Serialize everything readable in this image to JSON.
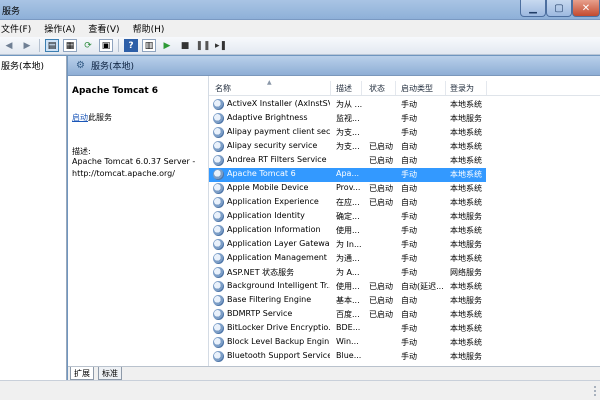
{
  "window": {
    "title": "服务"
  },
  "menu": [
    "文件(F)",
    "操作(A)",
    "查看(V)",
    "帮助(H)"
  ],
  "tree": {
    "root": "服务(本地)"
  },
  "pane_header": "服务(本地)",
  "detail": {
    "service_name": "Apache Tomcat 6",
    "start_link": "启动",
    "start_suffix": "此服务",
    "desc_label": "描述:",
    "desc_text": "Apache Tomcat 6.0.37 Server - http://tomcat.apache.org/"
  },
  "columns": [
    "名称",
    "描述",
    "状态",
    "启动类型",
    "登录为"
  ],
  "rows": [
    {
      "name": "ActiveX Installer (AxInstSV)",
      "desc": "为从 ...",
      "status": "",
      "startup": "手动",
      "logon": "本地系统"
    },
    {
      "name": "Adaptive Brightness",
      "desc": "监视...",
      "status": "",
      "startup": "手动",
      "logon": "本地服务"
    },
    {
      "name": "Alipay payment client sec...",
      "desc": "为支...",
      "status": "",
      "startup": "手动",
      "logon": "本地系统"
    },
    {
      "name": "Alipay security service",
      "desc": "为支...",
      "status": "已启动",
      "startup": "自动",
      "logon": "本地系统"
    },
    {
      "name": "Andrea RT Filters Service",
      "desc": "",
      "status": "已启动",
      "startup": "自动",
      "logon": "本地系统"
    },
    {
      "name": "Apache Tomcat 6",
      "desc": "Apa...",
      "status": "",
      "startup": "手动",
      "logon": "本地系统",
      "selected": true
    },
    {
      "name": "Apple Mobile Device",
      "desc": "Prov...",
      "status": "已启动",
      "startup": "自动",
      "logon": "本地系统"
    },
    {
      "name": "Application Experience",
      "desc": "在应...",
      "status": "已启动",
      "startup": "自动",
      "logon": "本地系统"
    },
    {
      "name": "Application Identity",
      "desc": "确定...",
      "status": "",
      "startup": "手动",
      "logon": "本地服务"
    },
    {
      "name": "Application Information",
      "desc": "使用...",
      "status": "",
      "startup": "手动",
      "logon": "本地系统"
    },
    {
      "name": "Application Layer Gatewa...",
      "desc": "为 In...",
      "status": "",
      "startup": "手动",
      "logon": "本地服务"
    },
    {
      "name": "Application Management",
      "desc": "为通...",
      "status": "",
      "startup": "手动",
      "logon": "本地系统"
    },
    {
      "name": "ASP.NET 状态服务",
      "desc": "为 A...",
      "status": "",
      "startup": "手动",
      "logon": "网络服务"
    },
    {
      "name": "Background Intelligent Tr...",
      "desc": "使用...",
      "status": "已启动",
      "startup": "自动(延迟...",
      "logon": "本地系统"
    },
    {
      "name": "Base Filtering Engine",
      "desc": "基本...",
      "status": "已启动",
      "startup": "自动",
      "logon": "本地服务"
    },
    {
      "name": "BDMRTP Service",
      "desc": "百度...",
      "status": "已启动",
      "startup": "自动",
      "logon": "本地系统"
    },
    {
      "name": "BitLocker Drive Encryptio...",
      "desc": "BDE...",
      "status": "",
      "startup": "手动",
      "logon": "本地系统"
    },
    {
      "name": "Block Level Backup Engin...",
      "desc": "Win...",
      "status": "",
      "startup": "手动",
      "logon": "本地系统"
    },
    {
      "name": "Bluetooth Support Service",
      "desc": "Blue...",
      "status": "",
      "startup": "手动",
      "logon": "本地服务"
    }
  ],
  "tabs": [
    "扩展",
    "标准"
  ],
  "icons": {
    "back": "arrow-left-icon",
    "forward": "arrow-right-icon",
    "console_tree": "console-tree-icon",
    "properties": "properties-icon",
    "refresh": "refresh-icon",
    "export": "export-list-icon",
    "help": "help-icon",
    "start": "play-icon",
    "stop": "stop-icon",
    "pause": "pause-icon",
    "restart": "restart-icon",
    "service": "gear-icon"
  }
}
